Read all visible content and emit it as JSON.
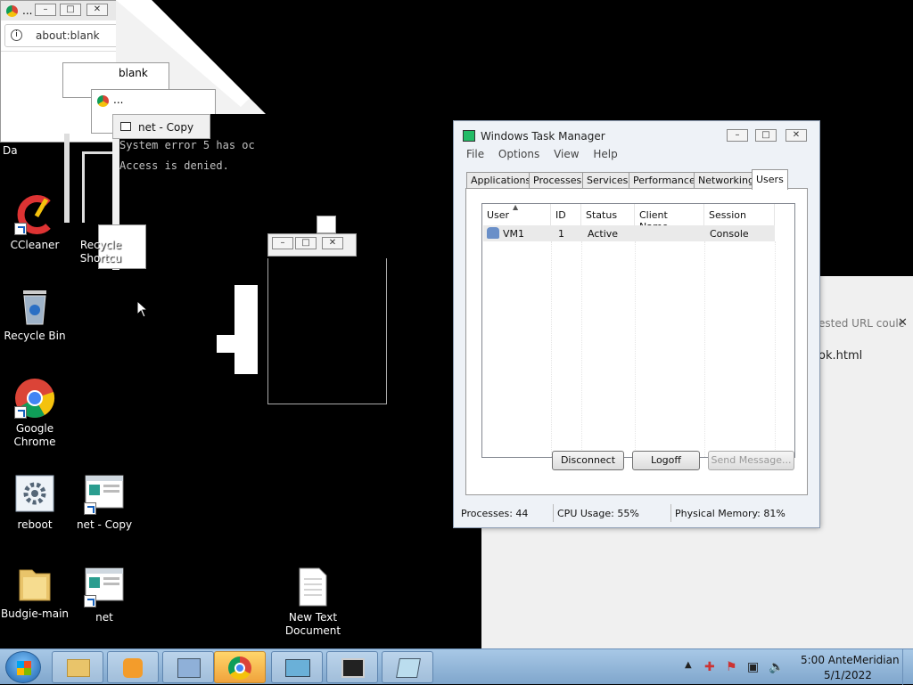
{
  "browser_windows": {
    "w1_title": "...",
    "w1_address": "about:blank",
    "w2_title": "blank",
    "w3_title": "..."
  },
  "console": {
    "title": "net - Copy",
    "line1": "System error 5 has oc",
    "line2": "Access is denied."
  },
  "desktop": {
    "partial_label": "Da",
    "icons": [
      {
        "label": "CCleaner"
      },
      {
        "label": "Recycle Bin"
      },
      {
        "label": "Google Chrome"
      },
      {
        "label": "reboot"
      },
      {
        "label": "Budgie-main"
      },
      {
        "label": "net - Copy"
      },
      {
        "label": "net"
      },
      {
        "label": "New Text Document"
      }
    ],
    "recycle_shortcut_label": "Recycle Shortcu"
  },
  "error_panel": {
    "message": "ested URL coulc",
    "file": "ok.html",
    "close_symbol": "✕"
  },
  "task_manager": {
    "title": "Windows Task Manager",
    "menu": [
      "File",
      "Options",
      "View",
      "Help"
    ],
    "tabs": [
      "Applications",
      "Processes",
      "Services",
      "Performance",
      "Networking",
      "Users"
    ],
    "columns": [
      "User",
      "ID",
      "Status",
      "Client Name",
      "Session"
    ],
    "rows": [
      {
        "user": "VM1",
        "id": "1",
        "status": "Active",
        "client": "",
        "session": "Console"
      }
    ],
    "buttons": {
      "disconnect": "Disconnect",
      "logoff": "Logoff",
      "send": "Send Message..."
    },
    "status": {
      "processes": "Processes: 44",
      "cpu": "CPU Usage: 55%",
      "memory": "Physical Memory: 81%"
    }
  },
  "taskbar": {
    "time": "5:00 AnteMeridian",
    "date": "5/1/2022"
  },
  "colors": {
    "accent": "#1560bd",
    "taskbar": "#8fb2d6",
    "chrome_red": "#db4437",
    "chrome_yellow": "#f4c20d",
    "chrome_green": "#0f9d58",
    "chrome_blue": "#4285f4"
  }
}
